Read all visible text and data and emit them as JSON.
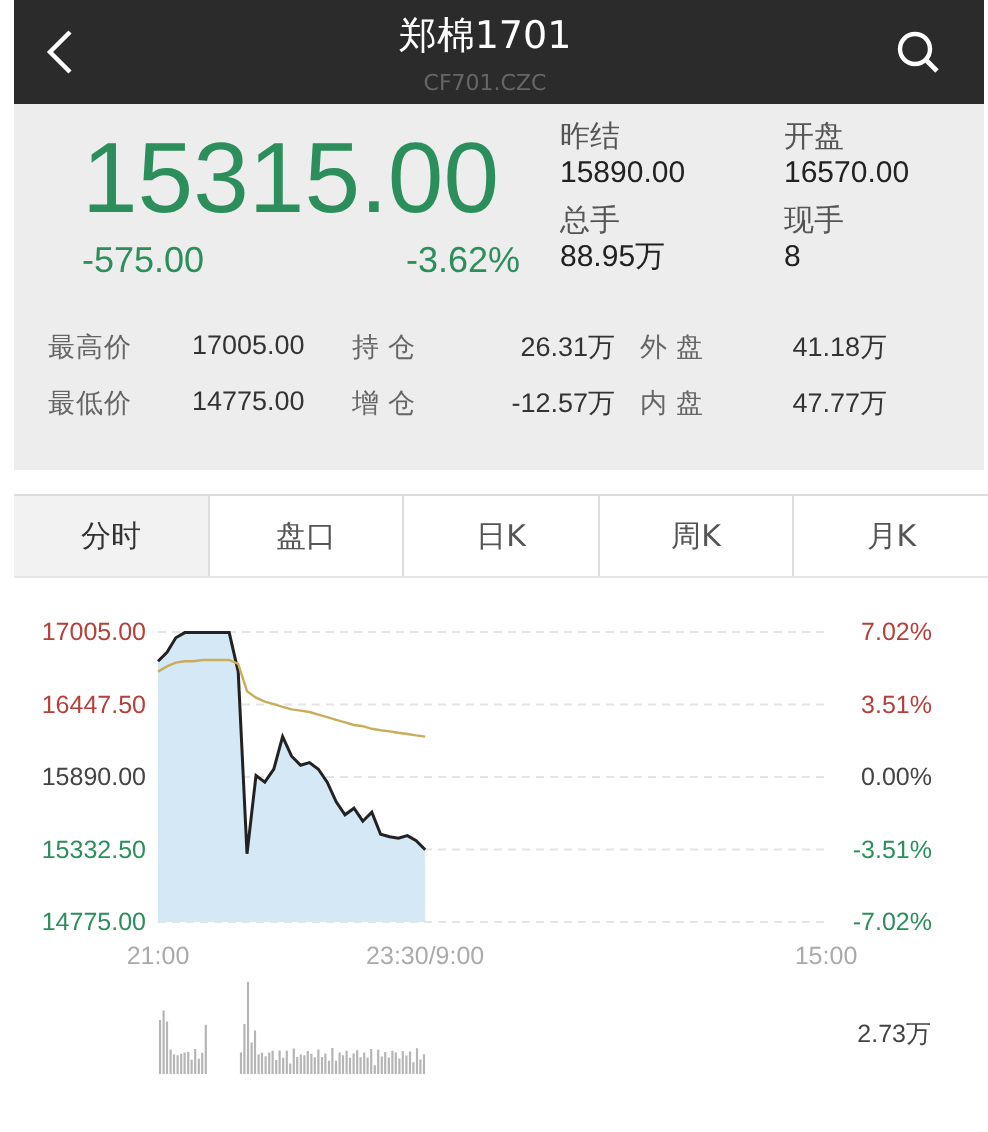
{
  "header": {
    "title": "郑棉1701",
    "subtitle": "CF701.CZC"
  },
  "quote": {
    "price": "15315.00",
    "change": "-575.00",
    "percent": "-3.62%",
    "stats": [
      {
        "label": "昨结",
        "value": "15890.00"
      },
      {
        "label": "开盘",
        "value": "16570.00"
      },
      {
        "label": "总手",
        "value": "88.95万"
      },
      {
        "label": "现手",
        "value": "8"
      }
    ]
  },
  "details": [
    {
      "cells": [
        "最高价",
        "17005.00",
        "持 仓",
        "26.31万",
        "外 盘",
        "41.18万"
      ]
    },
    {
      "cells": [
        "最低价",
        "14775.00",
        "增 仓",
        "-12.57万",
        "内 盘",
        "47.77万"
      ]
    }
  ],
  "tabs": [
    {
      "label": "分时",
      "selected": true
    },
    {
      "label": "盘口",
      "selected": false
    },
    {
      "label": "日K",
      "selected": false
    },
    {
      "label": "周K",
      "selected": false
    },
    {
      "label": "月K",
      "selected": false
    }
  ],
  "chart": {
    "right_axis": [
      {
        "label": "7.02%",
        "color": "#b5403a"
      },
      {
        "label": "3.51%",
        "color": "#b5403a"
      },
      {
        "label": "0.00%",
        "color": "#444444"
      },
      {
        "label": "-3.51%",
        "color": "#2c8f5b"
      },
      {
        "label": "-7.02%",
        "color": "#2c8f5b"
      }
    ],
    "chart_data": {
      "type": "line",
      "categories": [
        "21:00",
        null,
        null,
        null,
        null,
        null,
        null,
        null,
        null,
        null,
        null,
        null,
        null,
        null,
        null,
        null,
        null,
        null,
        null,
        null,
        null,
        null,
        null,
        null,
        null,
        null,
        null,
        null,
        null,
        null,
        "23:30/9:00",
        null,
        null,
        null,
        null,
        null,
        null,
        null,
        null,
        null,
        null,
        null,
        null,
        null,
        null,
        null,
        null,
        null,
        null,
        null,
        null,
        null,
        null,
        null,
        null,
        null,
        null,
        null,
        null,
        null,
        null,
        null,
        null,
        null,
        null,
        null,
        null,
        null,
        null,
        null,
        null,
        null,
        null,
        null,
        null,
        "15:00"
      ],
      "series": [
        {
          "color": "#222222",
          "values": [
            16780,
            16850,
            16960,
            17000,
            17000,
            17000,
            17000,
            17000,
            17000,
            16700,
            15300,
            15900,
            15850,
            15950,
            16200,
            16050,
            15980,
            16000,
            15950,
            15850,
            15700,
            15600,
            15650,
            15550,
            15620,
            15450,
            15430,
            15420,
            15440,
            15400,
            15330,
            null,
            null,
            null,
            null,
            null,
            null,
            null,
            null,
            null,
            null,
            null,
            null,
            null,
            null,
            null,
            null,
            null,
            null,
            null,
            null,
            null,
            null,
            null,
            null,
            null,
            null,
            null,
            null,
            null,
            null,
            null,
            null,
            null,
            null,
            null,
            null,
            null,
            null,
            null,
            null,
            null,
            null,
            null,
            null,
            null
          ]
        },
        {
          "color": "#c9ad5a",
          "values": [
            16700,
            16740,
            16770,
            16780,
            16780,
            16790,
            16790,
            16790,
            16790,
            16760,
            16550,
            16500,
            16470,
            16450,
            16430,
            16410,
            16400,
            16390,
            16370,
            16350,
            16330,
            16310,
            16290,
            16280,
            16260,
            16250,
            16240,
            16230,
            16220,
            16210,
            16200,
            null,
            null,
            null,
            null,
            null,
            null,
            null,
            null,
            null,
            null,
            null,
            null,
            null,
            null,
            null,
            null,
            null,
            null,
            null,
            null,
            null,
            null,
            null,
            null,
            null,
            null,
            null,
            null,
            null,
            null,
            null,
            null,
            null,
            null,
            null,
            null,
            null,
            null,
            null,
            null,
            null,
            null,
            null,
            null,
            null
          ]
        }
      ],
      "ylim": [
        14775,
        17005
      ],
      "grid": true,
      "yticks": [
        {
          "value": 14775,
          "label": "14775.00"
        },
        {
          "value": 15332.5,
          "label": "15332.50"
        },
        {
          "value": 15890,
          "label": "15890.00"
        },
        {
          "value": 16447.5,
          "label": "16447.50"
        },
        {
          "value": 17005,
          "label": "17005.00"
        }
      ]
    }
  },
  "volume": {
    "max_label": "2.73万"
  }
}
